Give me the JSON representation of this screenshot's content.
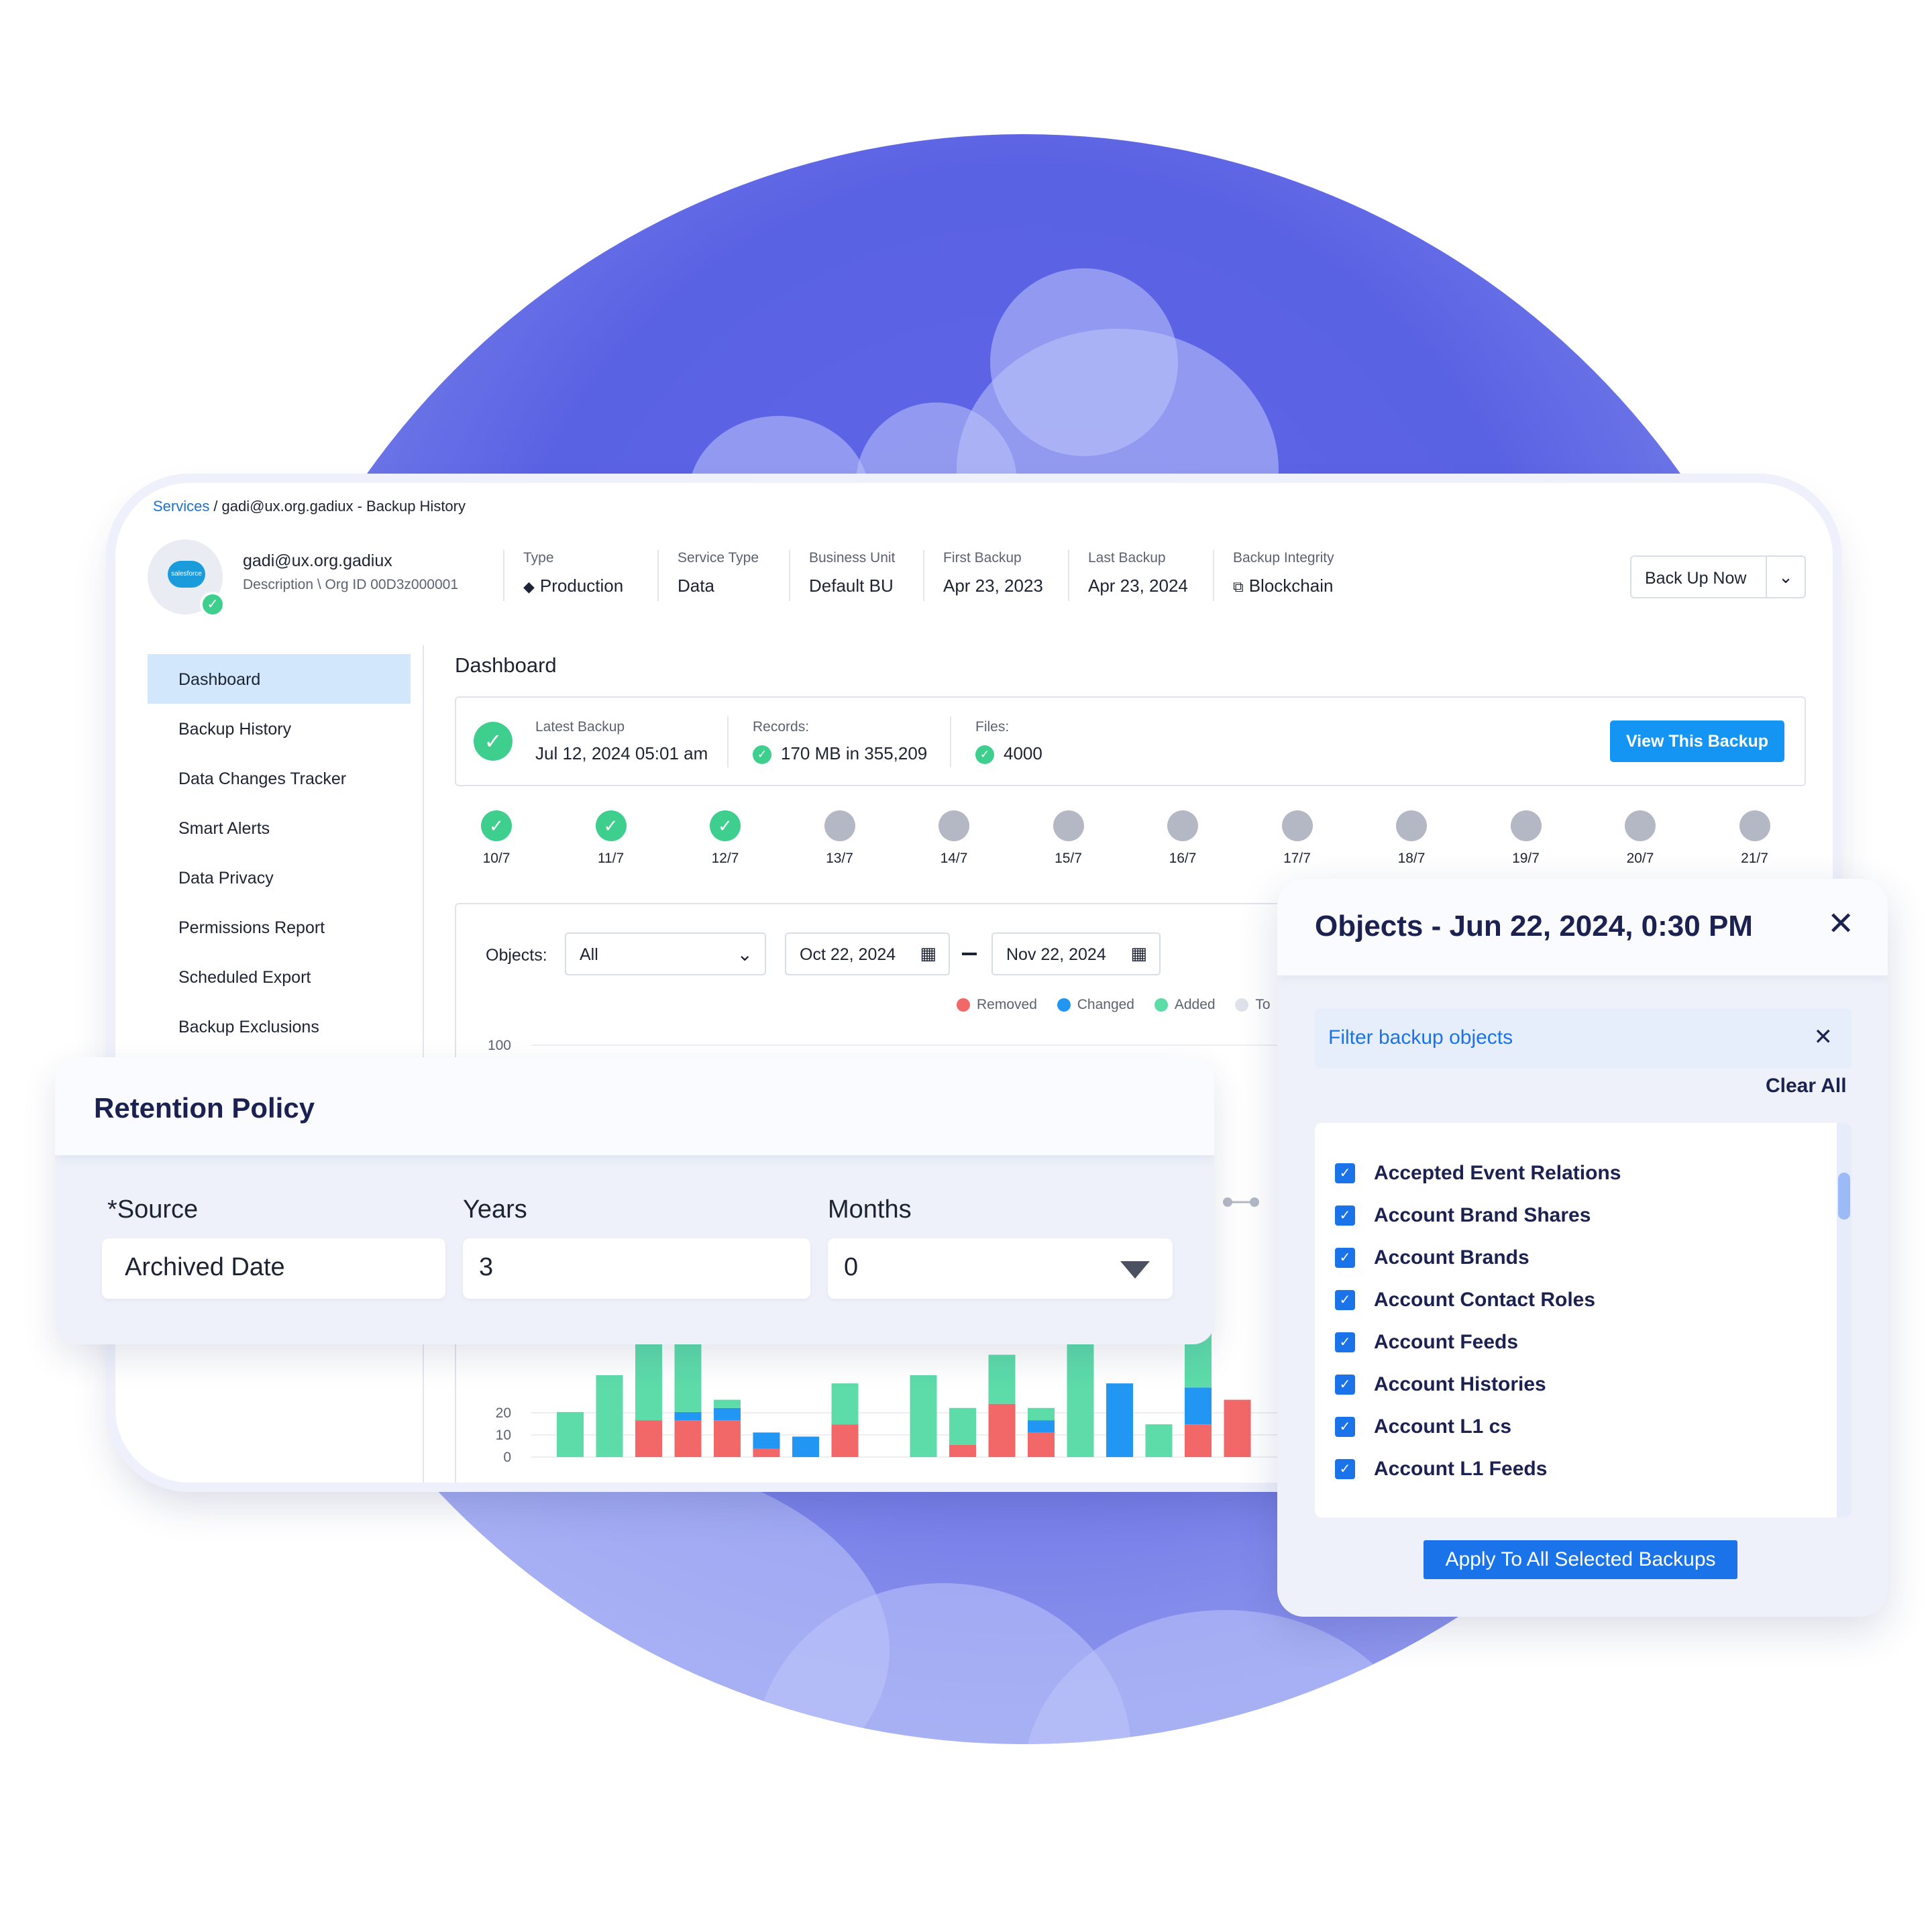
{
  "colors": {
    "background_circle": "#5a62e4",
    "primary_button": "#1595f3",
    "apply_button": "#1a73e8",
    "success": "#3ecf8e",
    "removed": "#f26868",
    "changed": "#2196f3",
    "added": "#5ddba9",
    "pending": "#b3b8c4",
    "active_nav": "#d2e7fb"
  },
  "breadcrumb": {
    "services": "Services",
    "separator": "/",
    "current": "gadi@ux.org.gadiux - Backup History"
  },
  "org": {
    "logo_text": "salesforce",
    "name": "gadi@ux.org.gadiux",
    "description": "Description \\ Org ID 00D3z000001"
  },
  "meta": [
    {
      "label": "Type",
      "value": "Production",
      "icon": "diamond-icon"
    },
    {
      "label": "Service Type",
      "value": "Data"
    },
    {
      "label": "Business Unit",
      "value": "Default BU"
    },
    {
      "label": "First Backup",
      "value": "Apr 23, 2023"
    },
    {
      "label": "Last Backup",
      "value": "Apr 23, 2024"
    },
    {
      "label": "Backup Integrity",
      "value": "Blockchain",
      "icon": "copy-icon"
    }
  ],
  "backup_now": {
    "label": "Back Up Now",
    "dropdown_icon": "chevron-down-icon"
  },
  "sidebar": {
    "items": [
      {
        "label": "Dashboard",
        "active": true
      },
      {
        "label": "Backup History"
      },
      {
        "label": "Data Changes Tracker"
      },
      {
        "label": "Smart Alerts"
      },
      {
        "label": "Data Privacy"
      },
      {
        "label": "Permissions Report"
      },
      {
        "label": "Scheduled Export"
      },
      {
        "label": "Backup Exclusions"
      }
    ]
  },
  "dashboard": {
    "title": "Dashboard",
    "latest_backup": {
      "label": "Latest Backup",
      "value": "Jul 12, 2024 05:01 am",
      "records_label": "Records:",
      "records_value": "170 MB in 355,209",
      "files_label": "Files:",
      "files_value": "4000",
      "view_button": "View This Backup"
    },
    "timeline": [
      {
        "date": "10/7",
        "status": "success"
      },
      {
        "date": "11/7",
        "status": "success"
      },
      {
        "date": "12/7",
        "status": "success"
      },
      {
        "date": "13/7",
        "status": "pending"
      },
      {
        "date": "14/7",
        "status": "pending"
      },
      {
        "date": "15/7",
        "status": "pending"
      },
      {
        "date": "16/7",
        "status": "pending"
      },
      {
        "date": "17/7",
        "status": "pending"
      },
      {
        "date": "18/7",
        "status": "pending"
      },
      {
        "date": "19/7",
        "status": "pending"
      },
      {
        "date": "20/7",
        "status": "pending"
      },
      {
        "date": "21/7",
        "status": "pending"
      }
    ],
    "filters": {
      "objects_label": "Objects:",
      "objects_value": "All",
      "date_from": "Oct 22, 2024",
      "date_to": "Nov 22, 2024"
    },
    "legend": [
      {
        "label": "Removed",
        "color": "#f26868"
      },
      {
        "label": "Changed",
        "color": "#2196f3"
      },
      {
        "label": "Added",
        "color": "#5ddba9"
      },
      {
        "label": "To",
        "color": "#dfe2ea"
      }
    ]
  },
  "chart_data": {
    "type": "bar",
    "stacked": true,
    "y_ticks": [
      "100",
      "20",
      "10",
      "0"
    ],
    "ylim": [
      0,
      100
    ],
    "series": [
      {
        "name": "Removed",
        "values": [
          0,
          0,
          9,
          9,
          9,
          2,
          0,
          8,
          0,
          0,
          3,
          13,
          6,
          0,
          0,
          0,
          8,
          14
        ]
      },
      {
        "name": "Changed",
        "values": [
          0,
          0,
          0,
          2,
          3,
          4,
          5,
          0,
          0,
          0,
          0,
          0,
          3,
          0,
          18,
          0,
          9,
          0
        ]
      },
      {
        "name": "Added",
        "values": [
          11,
          20,
          19,
          17,
          2,
          0,
          0,
          10,
          0,
          20,
          9,
          12,
          3,
          28,
          0,
          8,
          18,
          0
        ]
      }
    ],
    "grid": true,
    "legend_position": "top-right"
  },
  "retention": {
    "title": "Retention Policy",
    "source_label": "*Source",
    "source_value": "Archived Date",
    "years_label": "Years",
    "years_value": "3",
    "months_label": "Months",
    "months_value": "0"
  },
  "objects_panel": {
    "title": "Objects - Jun 22, 2024, 0:30 PM",
    "filter_placeholder": "Filter backup objects",
    "clear_all": "Clear All",
    "items": [
      "Accepted Event Relations",
      "Account Brand Shares",
      "Account Brands",
      "Account Contact Roles",
      "Account Feeds",
      "Account Histories",
      "Account L1 cs",
      "Account L1 Feeds"
    ],
    "apply_button": "Apply To All Selected Backups"
  }
}
